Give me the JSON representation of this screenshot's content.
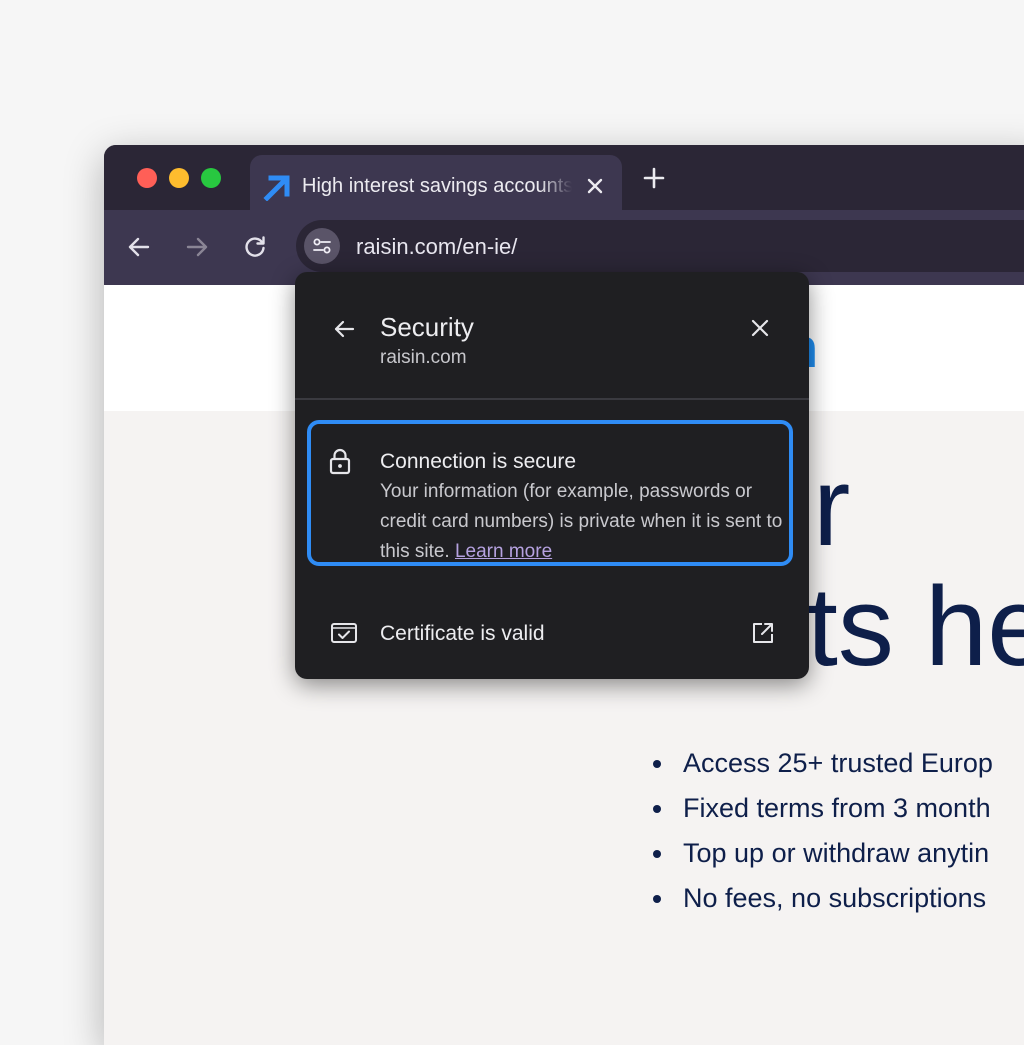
{
  "colors": {
    "accent_blue": "#2f8cf5",
    "link_purple": "#b6a2e0",
    "page_navy": "#0e1f4a",
    "traffic_red": "#ff5f57",
    "traffic_yellow": "#febc2e",
    "traffic_green": "#28c840"
  },
  "tab": {
    "title": "High interest savings accounts",
    "favicon": "raisin-arrow-icon"
  },
  "toolbar": {
    "url": "raisin.com/en-ie/",
    "icons": [
      "back-arrow-icon",
      "forward-arrow-icon",
      "reload-icon",
      "site-settings-icon"
    ]
  },
  "popup": {
    "title": "Security",
    "subtitle": "raisin.com",
    "connection": {
      "title": "Connection is secure",
      "description": "Your information (for example, passwords or credit card numbers) is private when it is sent to this site.",
      "link": "Learn more"
    },
    "certificate_label": "Certificate is valid"
  },
  "page": {
    "logo_tail": "n",
    "headline_line1": "arter",
    "headline_line2": "starts he",
    "bullets": [
      "Access 25+ trusted Europ",
      "Fixed terms from 3 month",
      "Top up or withdraw anytin",
      "No fees, no subscriptions"
    ]
  }
}
